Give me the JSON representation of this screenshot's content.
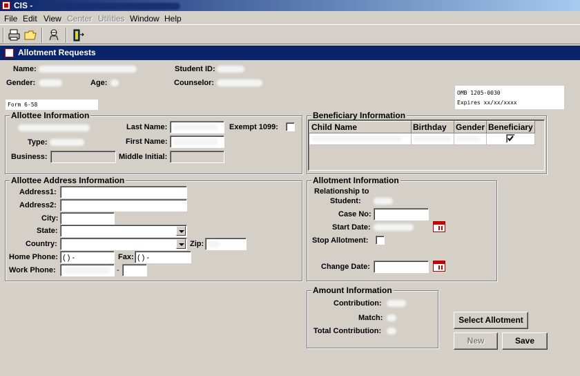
{
  "window": {
    "title": "CIS - ",
    "icon": "app-flag-icon"
  },
  "menubar": {
    "items": [
      {
        "label": "File",
        "enabled": true
      },
      {
        "label": "Edit",
        "enabled": true
      },
      {
        "label": "View",
        "enabled": true
      },
      {
        "label": "Center",
        "enabled": false
      },
      {
        "label": "Utilities",
        "enabled": false
      },
      {
        "label": "Window",
        "enabled": true
      },
      {
        "label": "Help",
        "enabled": true
      }
    ]
  },
  "toolbar": {
    "buttons": [
      "print-icon",
      "open-folder-icon",
      "find-person-icon",
      "exit-door-icon"
    ]
  },
  "child_window": {
    "title": "Allotment Requests"
  },
  "student": {
    "name_label": "Name:",
    "student_id_label": "Student ID:",
    "gender_label": "Gender:",
    "age_label": "Age:",
    "counselor_label": "Counselor:"
  },
  "omb": {
    "line1": "OMB 1205-0030",
    "line2": "Expires xx/xx/xxxx"
  },
  "form_number": "Form 6-58",
  "allottee": {
    "legend": "Allottee Information",
    "last_name_label": "Last Name:",
    "exempt_label": "Exempt 1099:",
    "type_label": "Type:",
    "first_name_label": "First Name:",
    "business_label": "Business:",
    "middle_initial_label": "Middle Initial:"
  },
  "beneficiary": {
    "legend": "Beneficiary Information",
    "columns": [
      "Child Name",
      "Birthday",
      "Gender",
      "Beneficiary"
    ]
  },
  "address": {
    "legend": "Allottee Address Information",
    "address1_label": "Address1:",
    "address2_label": "Address2:",
    "city_label": "City:",
    "state_label": "State:",
    "country_label": "Country:",
    "zip_label": "Zip:",
    "home_phone_label": "Home Phone:",
    "home_phone_value": "(   )    -",
    "fax_label": "Fax:",
    "fax_value": "(   )    -",
    "work_phone_label": "Work Phone:",
    "work_dash": "-"
  },
  "allotment": {
    "legend": "Allotment Information",
    "relationship_label_1": "Relationship to",
    "relationship_label_2": "Student:",
    "case_no_label": "Case No:",
    "start_date_label": "Start Date:",
    "stop_allotment_label": "Stop Allotment:",
    "change_date_label": "Change Date:"
  },
  "amount": {
    "legend": "Amount Information",
    "contribution_label": "Contribution:",
    "match_label": "Match:",
    "total_label": "Total Contribution:"
  },
  "buttons": {
    "select_allotment": "Select Allotment",
    "new": "New",
    "save": "Save"
  }
}
